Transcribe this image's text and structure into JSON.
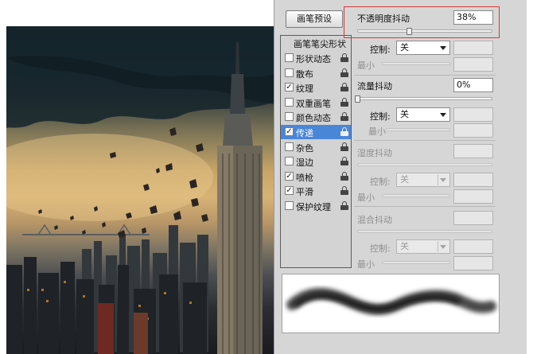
{
  "brush_panel": {
    "preset_button": "画笔预设",
    "list": {
      "header": "画笔笔尖形状",
      "items": [
        {
          "label": "形状动态",
          "checked": false
        },
        {
          "label": "散布",
          "checked": false
        },
        {
          "label": "纹理",
          "checked": true
        },
        {
          "label": "双重画笔",
          "checked": false
        },
        {
          "label": "颜色动态",
          "checked": false
        },
        {
          "label": "传递",
          "checked": true,
          "selected": true
        },
        {
          "label": "杂色",
          "checked": false
        },
        {
          "label": "湿边",
          "checked": false
        },
        {
          "label": "喷枪",
          "checked": true
        },
        {
          "label": "平滑",
          "checked": true
        },
        {
          "label": "保护纹理",
          "checked": false
        }
      ]
    },
    "opacity_jitter": {
      "label": "不透明度抖动",
      "value": "38%",
      "level": 0.38,
      "control_label": "控制:",
      "control_value": "关",
      "min_label": "最小"
    },
    "flow_jitter": {
      "label": "流量抖动",
      "value": "0%",
      "level": 0,
      "control_label": "控制:",
      "control_value": "关",
      "min_label": "最小"
    },
    "wetness_jitter": {
      "label": "湿度抖动",
      "control_label": "控制:",
      "control_value": "关",
      "min_label": "最小"
    },
    "mix_jitter": {
      "label": "混合抖动",
      "control_label": "控制:",
      "control_value": "关",
      "min_label": "最小"
    }
  },
  "colors": {
    "highlight": "#d33a3a",
    "selection": "#4a86d8"
  },
  "icons": {
    "lock": "lock-icon",
    "dropdown": "chevron-down-icon"
  }
}
